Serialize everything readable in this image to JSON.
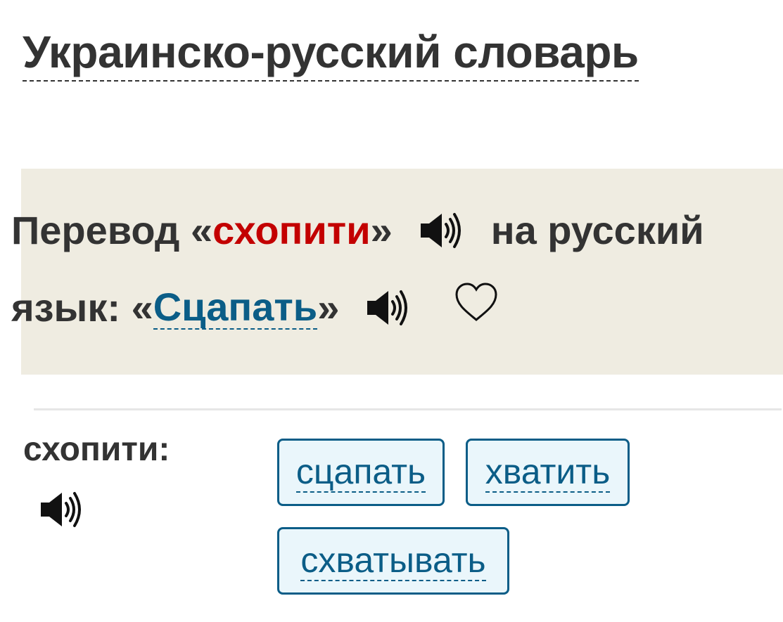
{
  "page": {
    "title": "Украинско-русский словарь"
  },
  "translation": {
    "prefix": "Перевод «",
    "source_word": "схопити",
    "middle": "»",
    "suffix_line1": "на русский",
    "line2_prefix": "язык: «",
    "target_word": "Сцапать",
    "line2_suffix": "»",
    "speaker_icon": "speaker-icon",
    "favorite_icon": "heart-icon"
  },
  "entry": {
    "headword": "схопити:",
    "synonyms": [
      "сцапать",
      "хватить",
      "схватывать"
    ]
  },
  "colors": {
    "source_word": "#c30000",
    "link": "#0b5d87",
    "box_background": "#efece1",
    "chip_background": "#eaf6fb",
    "text": "#333333"
  }
}
